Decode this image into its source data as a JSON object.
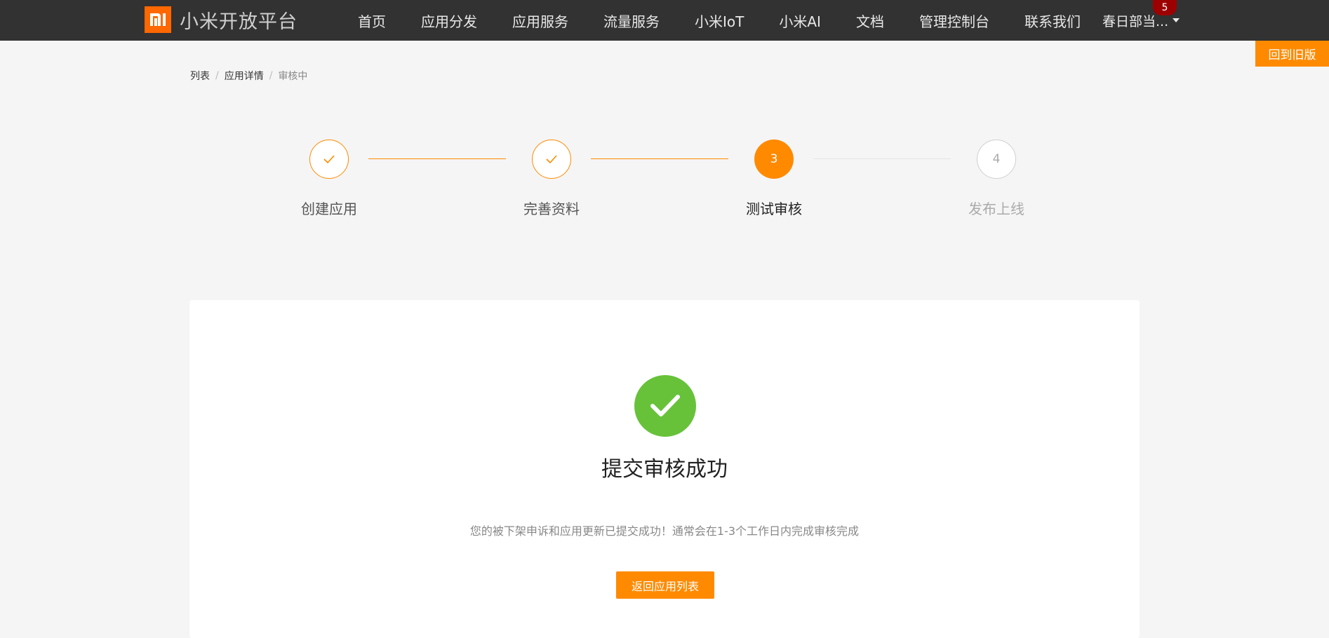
{
  "header": {
    "logo_icon": "mi-logo-icon",
    "brand_name": "小米开放平台",
    "nav": [
      {
        "label": "首页"
      },
      {
        "label": "应用分发"
      },
      {
        "label": "应用服务"
      },
      {
        "label": "流量服务"
      },
      {
        "label": "小米IoT"
      },
      {
        "label": "小米AI"
      },
      {
        "label": "文档"
      },
      {
        "label": "管理控制台"
      },
      {
        "label": "联系我们"
      }
    ],
    "user_name": "春日部当...",
    "notification_count": "5",
    "old_version_label": "回到旧版"
  },
  "breadcrumb": {
    "items": [
      "列表",
      "应用详情"
    ],
    "current": "审核中",
    "separator": "/"
  },
  "steps": [
    {
      "label": "创建应用",
      "status": "done",
      "icon": "check-icon"
    },
    {
      "label": "完善资料",
      "status": "done",
      "icon": "check-icon"
    },
    {
      "label": "测试审核",
      "status": "active",
      "number": "3"
    },
    {
      "label": "发布上线",
      "status": "todo",
      "number": "4"
    }
  ],
  "result": {
    "icon": "success-check-icon",
    "title": "提交审核成功",
    "description": "您的被下架申诉和应用更新已提交成功！通常会在1-3个工作日内完成审核完成",
    "button_label": "返回应用列表"
  },
  "colors": {
    "header_bg": "#323232",
    "brand_orange": "#ff6700",
    "accent": "#ff8a00",
    "success_green": "#67c23a",
    "badge_red": "#9d0000",
    "page_bg": "#f5f5f5"
  }
}
